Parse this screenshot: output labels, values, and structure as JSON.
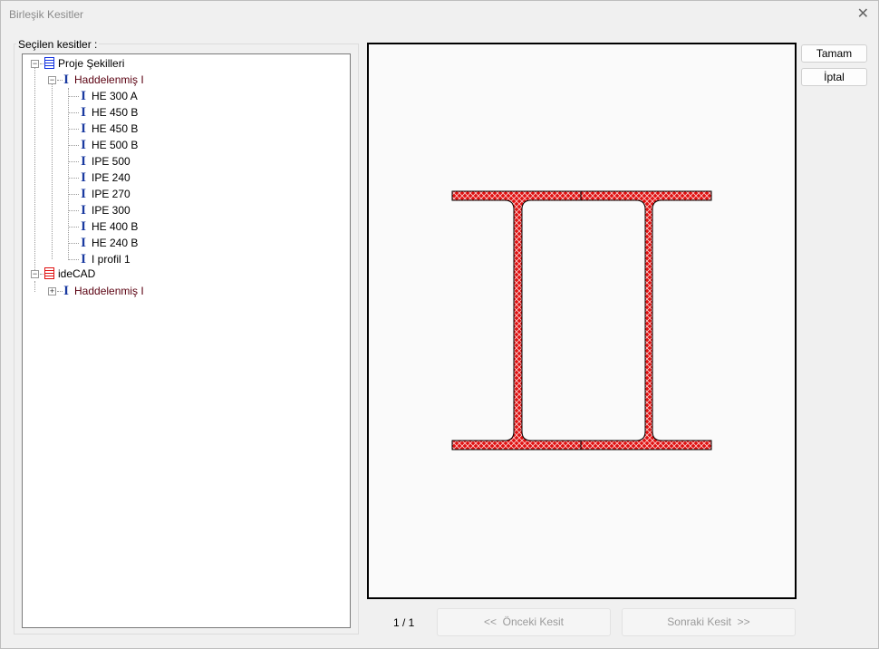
{
  "window": {
    "title": "Birleşik Kesitler"
  },
  "group_label": "Seçilen kesitler :",
  "tree": {
    "root1": {
      "label": "Proje Şekilleri",
      "child": {
        "label": "Haddelenmiş I",
        "items": [
          "HE 300 A",
          "HE 450 B",
          "HE 450 B",
          "HE 500 B",
          "IPE 500",
          "IPE 240",
          "IPE 270",
          "IPE 300",
          "HE 400 B",
          "HE 240 B",
          "I profil 1"
        ]
      }
    },
    "root2": {
      "label": "ideCAD",
      "child": {
        "label": "Haddelenmiş I"
      }
    }
  },
  "buttons": {
    "ok": "Tamam",
    "cancel": "İptal",
    "prev": "<<  Önceki Kesit",
    "next": "Sonraki Kesit  >>"
  },
  "pager": "1 / 1",
  "colors": {
    "section_fill": "#e01010",
    "heading_color": "#5a0010"
  }
}
